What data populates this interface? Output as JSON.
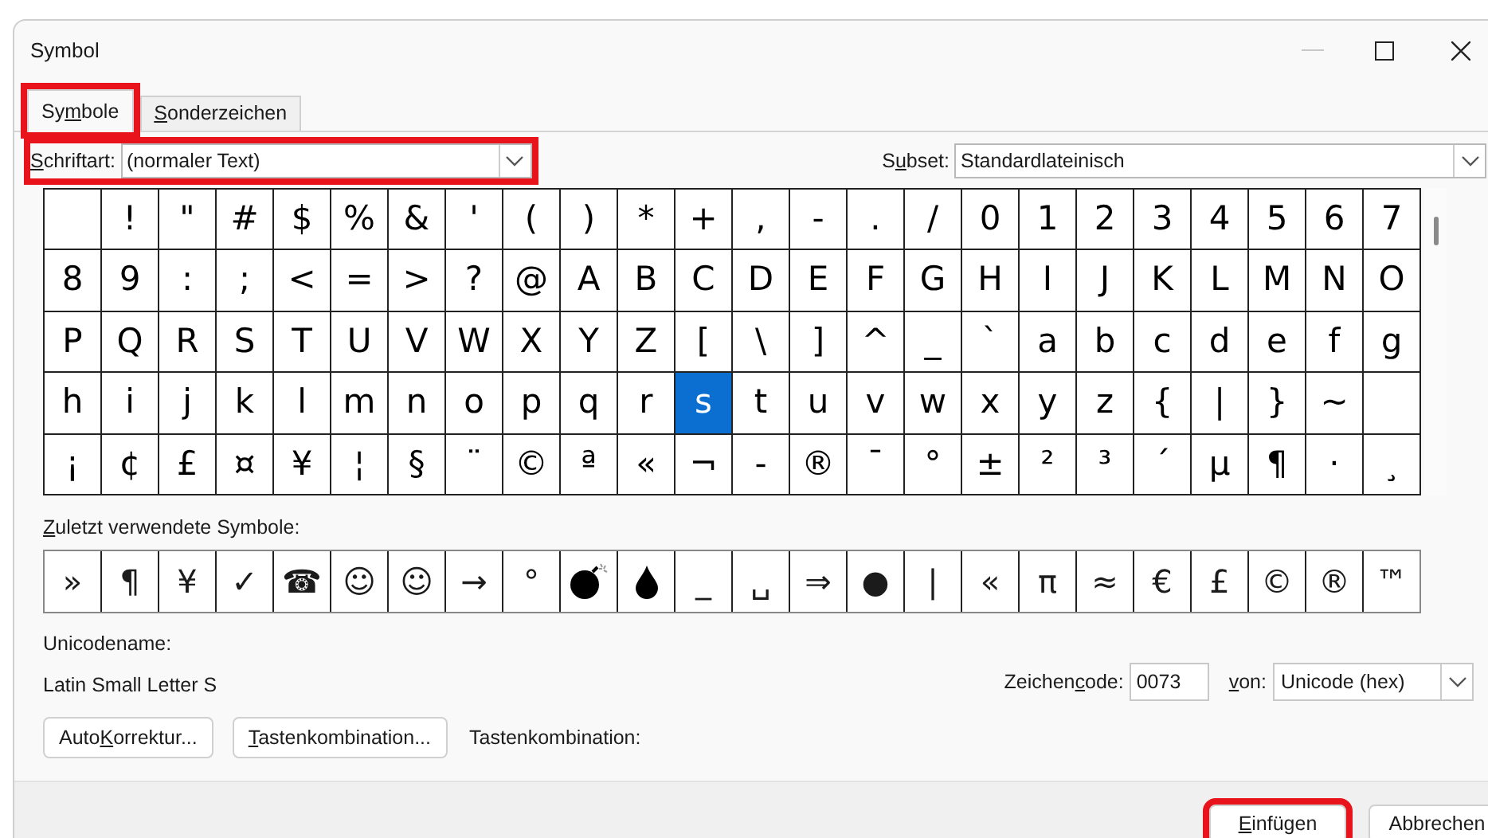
{
  "window": {
    "title": "Symbol",
    "minimize_disabled": true
  },
  "tabs": [
    {
      "label": {
        "pre": "Sy",
        "key": "m",
        "post": "bole"
      },
      "selected": true,
      "highlighted": true
    },
    {
      "label": {
        "key": "S",
        "post": "onderzeichen"
      },
      "selected": false,
      "highlighted": false
    }
  ],
  "font": {
    "label": {
      "key": "S",
      "post": "chriftart:"
    },
    "value": "(normaler Text)",
    "highlighted": true
  },
  "subset": {
    "label": {
      "pre": "S",
      "key": "u",
      "post": "bset:"
    },
    "value": "Standardlateinisch",
    "highlighted": false
  },
  "grid": [
    [
      {
        "selected": false
      },
      {
        "char": "!",
        "selected": false
      },
      {
        "char": "\"",
        "selected": false
      },
      {
        "char": "#",
        "selected": false
      },
      {
        "char": "$",
        "selected": false
      },
      {
        "char": "%",
        "selected": false
      },
      {
        "char": "&",
        "selected": false
      },
      {
        "char": "'",
        "selected": false
      },
      {
        "char": "(",
        "selected": false
      },
      {
        "char": ")",
        "selected": false
      },
      {
        "char": "*",
        "selected": false
      },
      {
        "char": "+",
        "selected": false
      },
      {
        "char": ",",
        "selected": false
      },
      {
        "char": "-",
        "selected": false
      },
      {
        "char": ".",
        "selected": false
      },
      {
        "char": "/",
        "selected": false
      },
      {
        "char": "0",
        "selected": false
      },
      {
        "char": "1",
        "selected": false
      },
      {
        "char": "2",
        "selected": false
      },
      {
        "char": "3",
        "selected": false
      },
      {
        "char": "4",
        "selected": false
      },
      {
        "char": "5",
        "selected": false
      },
      {
        "char": "6",
        "selected": false
      },
      {
        "char": "7",
        "selected": false
      }
    ],
    [
      {
        "char": "8",
        "selected": false
      },
      {
        "char": "9",
        "selected": false
      },
      {
        "char": ":",
        "selected": false
      },
      {
        "char": ";",
        "selected": false
      },
      {
        "char": "<",
        "selected": false
      },
      {
        "char": "=",
        "selected": false
      },
      {
        "char": ">",
        "selected": false
      },
      {
        "char": "?",
        "selected": false
      },
      {
        "char": "@",
        "selected": false
      },
      {
        "char": "A",
        "selected": false
      },
      {
        "char": "B",
        "selected": false
      },
      {
        "char": "C",
        "selected": false
      },
      {
        "char": "D",
        "selected": false
      },
      {
        "char": "E",
        "selected": false
      },
      {
        "char": "F",
        "selected": false
      },
      {
        "char": "G",
        "selected": false
      },
      {
        "char": "H",
        "selected": false
      },
      {
        "char": "I",
        "selected": false
      },
      {
        "char": "J",
        "selected": false
      },
      {
        "char": "K",
        "selected": false
      },
      {
        "char": "L",
        "selected": false
      },
      {
        "char": "M",
        "selected": false
      },
      {
        "char": "N",
        "selected": false
      },
      {
        "char": "O",
        "selected": false
      }
    ],
    [
      {
        "char": "P",
        "selected": false
      },
      {
        "char": "Q",
        "selected": false
      },
      {
        "char": "R",
        "selected": false
      },
      {
        "char": "S",
        "selected": false
      },
      {
        "char": "T",
        "selected": false
      },
      {
        "char": "U",
        "selected": false
      },
      {
        "char": "V",
        "selected": false
      },
      {
        "char": "W",
        "selected": false
      },
      {
        "char": "X",
        "selected": false
      },
      {
        "char": "Y",
        "selected": false
      },
      {
        "char": "Z",
        "selected": false
      },
      {
        "char": "[",
        "selected": false
      },
      {
        "char": "\\",
        "selected": false
      },
      {
        "char": "]",
        "selected": false
      },
      {
        "char": "^",
        "selected": false
      },
      {
        "char": "_",
        "selected": false
      },
      {
        "char": "`",
        "selected": false
      },
      {
        "char": "a",
        "selected": false
      },
      {
        "char": "b",
        "selected": false
      },
      {
        "char": "c",
        "selected": false
      },
      {
        "char": "d",
        "selected": false
      },
      {
        "char": "e",
        "selected": false
      },
      {
        "char": "f",
        "selected": false
      },
      {
        "char": "g",
        "selected": false
      }
    ],
    [
      {
        "char": "h",
        "selected": false
      },
      {
        "char": "i",
        "selected": false
      },
      {
        "char": "j",
        "selected": false
      },
      {
        "char": "k",
        "selected": false
      },
      {
        "char": "l",
        "selected": false
      },
      {
        "char": "m",
        "selected": false
      },
      {
        "char": "n",
        "selected": false
      },
      {
        "char": "o",
        "selected": false
      },
      {
        "char": "p",
        "selected": false
      },
      {
        "char": "q",
        "selected": false
      },
      {
        "char": "r",
        "selected": false
      },
      {
        "char": "s",
        "selected": true
      },
      {
        "char": "t",
        "selected": false
      },
      {
        "char": "u",
        "selected": false
      },
      {
        "char": "v",
        "selected": false
      },
      {
        "char": "w",
        "selected": false
      },
      {
        "char": "x",
        "selected": false
      },
      {
        "char": "y",
        "selected": false
      },
      {
        "char": "z",
        "selected": false
      },
      {
        "char": "{",
        "selected": false
      },
      {
        "char": "|",
        "selected": false
      },
      {
        "char": "}",
        "selected": false
      },
      {
        "char": "~",
        "selected": false
      },
      {
        "selected": false
      }
    ],
    [
      {
        "char": "¡",
        "selected": false
      },
      {
        "char": "¢",
        "selected": false
      },
      {
        "char": "£",
        "selected": false
      },
      {
        "char": "¤",
        "selected": false
      },
      {
        "char": "¥",
        "selected": false
      },
      {
        "char": "¦",
        "selected": false
      },
      {
        "char": "§",
        "selected": false
      },
      {
        "char": "¨",
        "selected": false
      },
      {
        "char": "©",
        "selected": false
      },
      {
        "char": "ª",
        "selected": false
      },
      {
        "char": "«",
        "selected": false
      },
      {
        "char": "¬",
        "selected": false
      },
      {
        "char": "-",
        "selected": false
      },
      {
        "char": "®",
        "selected": false
      },
      {
        "char": "¯",
        "selected": false
      },
      {
        "char": "°",
        "selected": false
      },
      {
        "char": "±",
        "selected": false
      },
      {
        "char": "²",
        "selected": false
      },
      {
        "char": "³",
        "selected": false
      },
      {
        "char": "´",
        "selected": false
      },
      {
        "char": "µ",
        "selected": false
      },
      {
        "char": "¶",
        "selected": false
      },
      {
        "char": "·",
        "selected": false
      },
      {
        "char": "¸",
        "selected": false
      }
    ]
  ],
  "recent": {
    "label": {
      "key": "Z",
      "post": "uletzt verwendete Symbole:"
    },
    "symbols": [
      {
        "kind": "glyph",
        "char": "»"
      },
      {
        "kind": "glyph",
        "char": "¶"
      },
      {
        "kind": "glyph",
        "char": "¥"
      },
      {
        "kind": "glyph",
        "char": "✓"
      },
      {
        "kind": "glyph",
        "char": "☎"
      },
      {
        "kind": "glyph",
        "char": "☺"
      },
      {
        "kind": "glyph",
        "char": "☺"
      },
      {
        "kind": "glyph",
        "char": "→"
      },
      {
        "kind": "glyph",
        "char": "°"
      },
      {
        "kind": "bomb"
      },
      {
        "kind": "drop"
      },
      {
        "kind": "glyph",
        "char": "_"
      },
      {
        "kind": "glyph",
        "char": "␣"
      },
      {
        "kind": "glyph",
        "char": "⇒"
      },
      {
        "kind": "glyph",
        "char": "●"
      },
      {
        "kind": "glyph",
        "char": "|"
      },
      {
        "kind": "glyph",
        "char": "«"
      },
      {
        "kind": "glyph",
        "char": "π"
      },
      {
        "kind": "glyph",
        "char": "≈"
      },
      {
        "kind": "glyph",
        "char": "€"
      },
      {
        "kind": "glyph",
        "char": "£"
      },
      {
        "kind": "glyph",
        "char": "©"
      },
      {
        "kind": "glyph",
        "char": "®"
      },
      {
        "kind": "glyph",
        "char": "™"
      }
    ]
  },
  "unicode_name": {
    "label": "Unicodename:",
    "value": "Latin Small Letter S"
  },
  "char_code": {
    "label": {
      "pre": "Zeichen",
      "key": "c",
      "post": "ode:"
    },
    "value": "0073"
  },
  "from": {
    "label": {
      "key": "v",
      "post": "on:"
    },
    "value": "Unicode (hex)"
  },
  "action_buttons": [
    {
      "label": {
        "pre": "Auto",
        "key": "K",
        "post": "orrektur..."
      }
    },
    {
      "label": {
        "key": "T",
        "post": "astenkombination..."
      }
    }
  ],
  "shortcut_label": "Tastenkombination:",
  "buttons": [
    {
      "label": {
        "key": "E",
        "post": "infügen"
      },
      "highlighted": true
    },
    {
      "label": {
        "post": "Abbrechen"
      },
      "highlighted": false
    }
  ]
}
